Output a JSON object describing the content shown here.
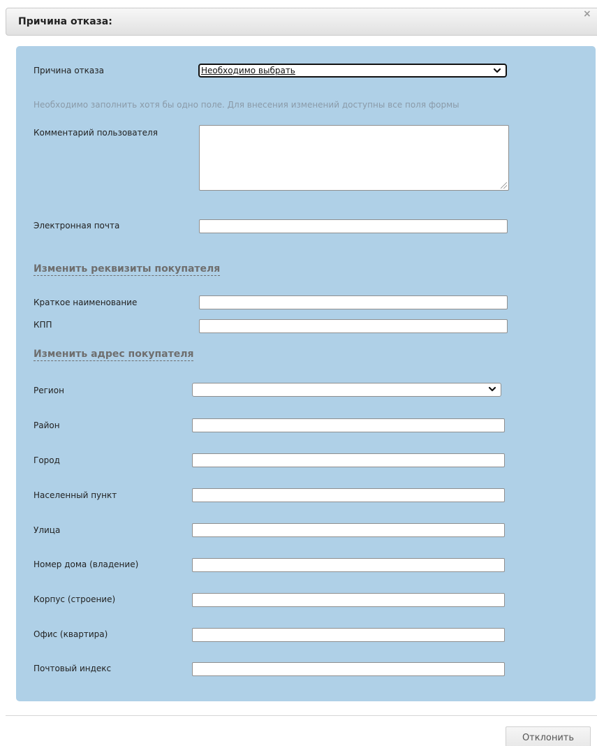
{
  "dialog": {
    "title": "Причина отказа:",
    "close_icon": "close-icon"
  },
  "form": {
    "reason_label": "Причина отказа",
    "reason_select_value": "Необходимо выбрать",
    "hint": "Необходимо заполнить хотя бы одно поле. Для внесения изменений доступны все поля формы",
    "comment_label": "Комментарий пользователя",
    "comment_value": "",
    "email_label": "Электронная почта",
    "email_value": ""
  },
  "buyer_details": {
    "link_label": "Изменить реквизиты покупателя",
    "short_name_label": "Краткое наименование",
    "short_name_value": "",
    "kpp_label": "КПП",
    "kpp_value": ""
  },
  "buyer_address": {
    "link_label": "Изменить адрес покупателя",
    "region_label": "Регион",
    "region_value": "",
    "district_label": "Район",
    "city_label": "Город",
    "settlement_label": "Населенный пункт",
    "street_label": "Улица",
    "house_label": "Номер дома (владение)",
    "building_label": "Корпус (строение)",
    "office_label": "Офис (квартира)",
    "postal_code_label": "Почтовый индекс"
  },
  "footer": {
    "reject_label": "Отклонить"
  },
  "colors": {
    "panel_background": "#afd0e7",
    "hint_text": "#8a9aa8",
    "link_text": "#6e6e6e"
  }
}
